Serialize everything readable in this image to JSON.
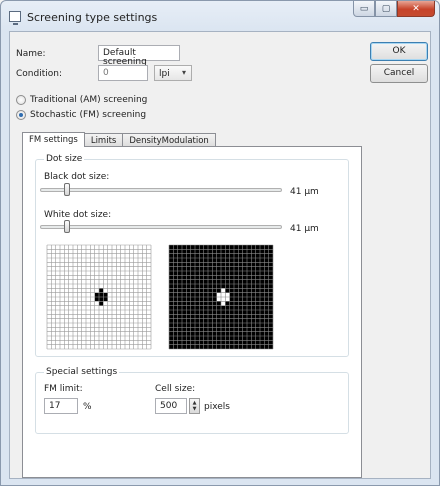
{
  "window": {
    "title": "Screening type settings",
    "caption_buttons": {
      "minimize": "▭",
      "maximize": "▢",
      "close": "✕"
    }
  },
  "form": {
    "name_label": "Name:",
    "name_value": "Default screening",
    "condition_label": "Condition:",
    "condition_value": "0",
    "unit_value": "lpi",
    "unit_arrow": "▾"
  },
  "buttons": {
    "ok": "OK",
    "cancel": "Cancel"
  },
  "screening_modes": {
    "am_label": "Traditional (AM) screening",
    "fm_label": "Stochastic (FM) screening",
    "selected": "fm"
  },
  "tabs": [
    "FM settings",
    "Limits",
    "DensityModulation"
  ],
  "active_tab": 0,
  "dot_size": {
    "group_title": "Dot size",
    "black_label": "Black dot size:",
    "black_value": "41 µm",
    "black_fraction": 0.1,
    "white_label": "White dot size:",
    "white_value": "41 µm",
    "white_fraction": 0.1
  },
  "dot_preview": {
    "grid_cells": 24,
    "pattern": [
      [
        0,
        1,
        0
      ],
      [
        1,
        1,
        1
      ],
      [
        1,
        1,
        1
      ],
      [
        0,
        1,
        0
      ]
    ],
    "left_colors": {
      "background": "#ffffff",
      "grid": "#9a9a9a",
      "dot": "#000000"
    },
    "right_colors": {
      "background": "#000000",
      "grid": "#8a8a8a",
      "dot": "#ffffff"
    }
  },
  "special_settings": {
    "group_title": "Special settings",
    "fm_limit_label": "FM limit:",
    "fm_limit_value": "17",
    "fm_limit_unit": "%",
    "cell_size_label": "Cell size:",
    "cell_size_value": "500",
    "cell_size_unit": "pixels",
    "spin_up": "▲",
    "spin_down": "▼"
  },
  "colors": {
    "accent": "#2f6db0",
    "window_frame": "#dbe5f1",
    "close_button": "#c7432a"
  }
}
